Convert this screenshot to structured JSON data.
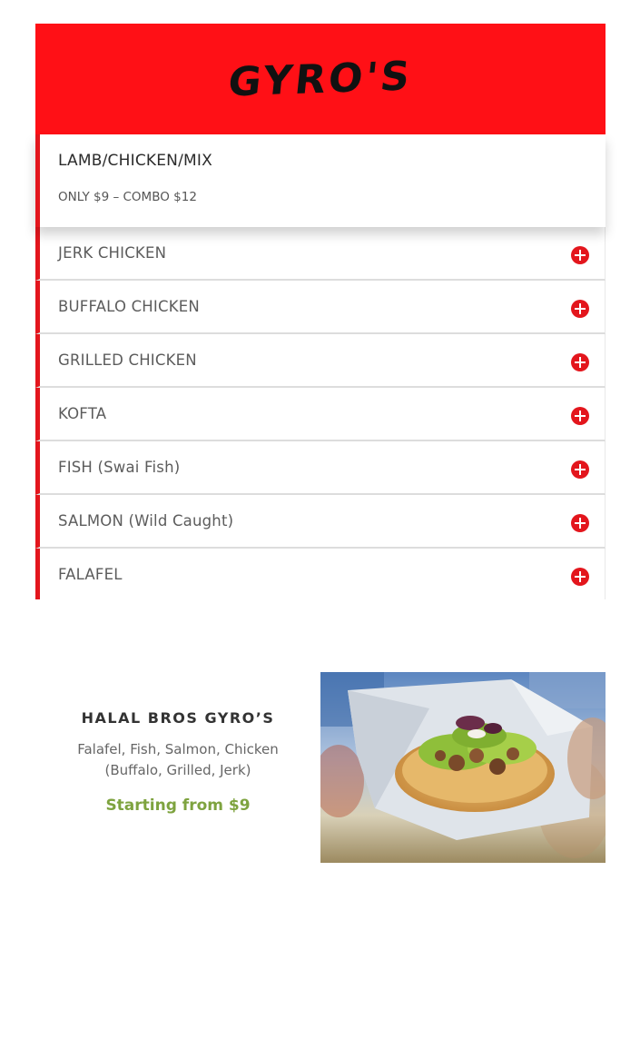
{
  "header": {
    "title": "GYRO'S"
  },
  "menu": {
    "open_item": {
      "title": "LAMB/CHICKEN/MIX",
      "body": "ONLY $9 – COMBO $12"
    },
    "items": [
      {
        "label": "JERK CHICKEN"
      },
      {
        "label": "BUFFALO CHICKEN"
      },
      {
        "label": "GRILLED CHICKEN"
      },
      {
        "label": "KOFTA"
      },
      {
        "label": "FISH (Swai Fish)"
      },
      {
        "label": "SALMON (Wild Caught)"
      },
      {
        "label": "FALAFEL"
      }
    ]
  },
  "promo": {
    "title": "HALAL BROS GYRO’S",
    "description": "Falafel, Fish, Salmon, Chicken (Buffalo, Grilled, Jerk)",
    "price": "Starting from $9",
    "price_color": "#7ea33f"
  },
  "colors": {
    "brand_red": "#ff1016",
    "accent_red": "#e3161d"
  },
  "icons": {
    "toggle": "plus-circle-icon"
  }
}
